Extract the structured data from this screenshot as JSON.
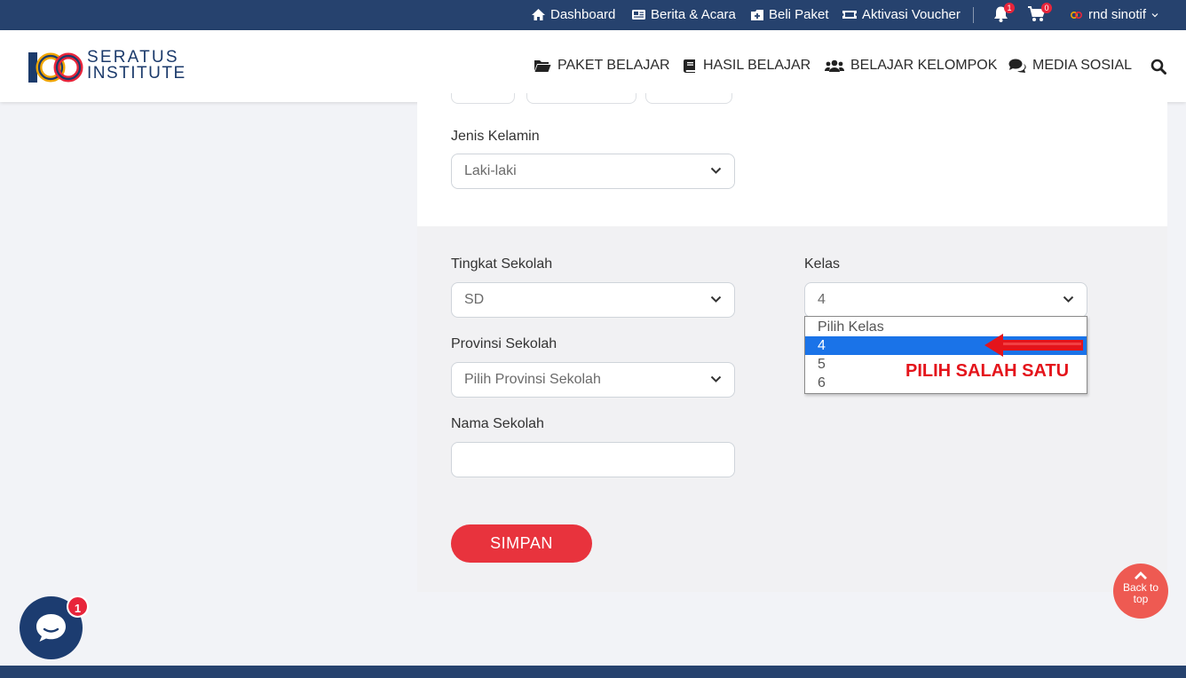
{
  "topbar": {
    "links": [
      {
        "label": "Dashboard",
        "icon": "home-icon"
      },
      {
        "label": "Berita & Acara",
        "icon": "newspaper-icon"
      },
      {
        "label": "Beli Paket",
        "icon": "package-icon"
      },
      {
        "label": "Aktivasi Voucher",
        "icon": "ticket-icon"
      }
    ],
    "notification_count": "1",
    "cart_count": "0",
    "user_name": "rnd sinotif"
  },
  "header": {
    "logo_line1": "SERATUS",
    "logo_line2": "INSTITUTE",
    "nav": [
      {
        "label": "PAKET BELAJAR",
        "icon": "folder-icon"
      },
      {
        "label": "HASIL BELAJAR",
        "icon": "book-icon"
      },
      {
        "label": "BELAJAR KELOMPOK",
        "icon": "users-icon"
      },
      {
        "label": "MEDIA SOSIAL",
        "icon": "comments-icon"
      }
    ]
  },
  "form": {
    "gender_label": "Jenis Kelamin",
    "gender_value": "Laki-laki",
    "school_level_label": "Tingkat Sekolah",
    "school_level_value": "SD",
    "class_label": "Kelas",
    "class_value": "4",
    "class_options": [
      "Pilih Kelas",
      "4",
      "5",
      "6"
    ],
    "province_label": "Provinsi Sekolah",
    "province_value": "Pilih Provinsi Sekolah",
    "school_name_label": "Nama Sekolah",
    "school_name_value": "",
    "save_label": "SIMPAN"
  },
  "annotation": "PILIH SALAH SATU",
  "back_to_top": [
    "Back to",
    "top"
  ],
  "chat_badge": "1",
  "colors": {
    "topbar": "#26426e",
    "primary_button": "#e8333d",
    "selected_option": "#1a73e8",
    "annotation": "#e4141b",
    "chat_button": "#1c3c70"
  }
}
